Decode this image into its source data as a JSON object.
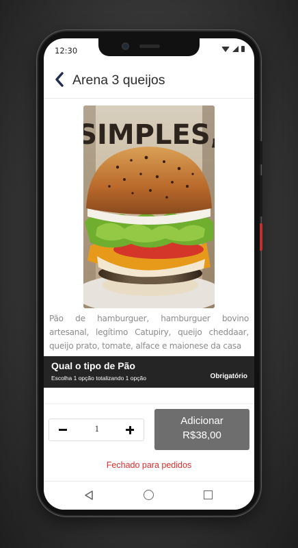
{
  "status_bar": {
    "time": "12:30",
    "icons": [
      "wifi-icon",
      "signal-icon",
      "battery-icon"
    ]
  },
  "header": {
    "title": "Arena 3 queijos",
    "back_icon": "chevron-left-icon"
  },
  "product": {
    "image_text": "SIMPLES,",
    "description": "Pão de hamburguer, hamburguer bovino artesanal, legítimo Catupiry, queijo cheddaar, queijo prato, tomate, alface e maionese da casa"
  },
  "option_section": {
    "title": "Qual o tipo de Pão",
    "subtitle": "Escolha 1 opção totalizando 1 opção",
    "required_label": "Obrigatório"
  },
  "order": {
    "quantity": "1",
    "add_label": "Adicionar",
    "price": "R$38,00",
    "closed_message": "Fechado para pedidos"
  },
  "colors": {
    "section_bar": "#252525",
    "add_button": "#6e6e6e",
    "closed_text": "#e32b2b"
  },
  "nav_bar": {
    "icons": [
      "nav-back-icon",
      "nav-home-icon",
      "nav-recent-icon"
    ]
  }
}
